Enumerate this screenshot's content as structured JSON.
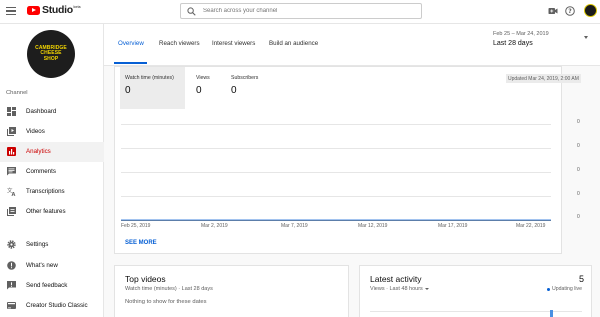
{
  "app": {
    "logo_text": "Studio",
    "logo_sup": "beta"
  },
  "search": {
    "placeholder": "Search across your channel"
  },
  "channel": {
    "logo_lines": [
      "CAMBRIDGE",
      "CHEESE",
      "SHOP"
    ],
    "section_label": "Channel"
  },
  "sidebar": {
    "items": [
      {
        "label": "Dashboard",
        "icon": "dashboard-icon",
        "active": false
      },
      {
        "label": "Videos",
        "icon": "videos-icon",
        "active": false
      },
      {
        "label": "Analytics",
        "icon": "analytics-icon",
        "active": true
      },
      {
        "label": "Comments",
        "icon": "comments-icon",
        "active": false
      },
      {
        "label": "Transcriptions",
        "icon": "transcriptions-icon",
        "active": false
      },
      {
        "label": "Other features",
        "icon": "other-features-icon",
        "active": false
      }
    ],
    "bottom_items": [
      {
        "label": "Settings",
        "icon": "settings-icon"
      },
      {
        "label": "What's new",
        "icon": "whats-new-icon"
      },
      {
        "label": "Send feedback",
        "icon": "feedback-icon"
      },
      {
        "label": "Creator Studio Classic",
        "icon": "classic-icon"
      }
    ]
  },
  "tabs": [
    {
      "label": "Overview",
      "active": true
    },
    {
      "label": "Reach viewers",
      "active": false
    },
    {
      "label": "Interest viewers",
      "active": false
    },
    {
      "label": "Build an audience",
      "active": false
    }
  ],
  "date_filter": {
    "range": "Feb 25 – Mar 24, 2019",
    "preset": "Last 28 days"
  },
  "metrics": [
    {
      "label": "Watch time (minutes)",
      "value": "0",
      "selected": true
    },
    {
      "label": "Views",
      "value": "0",
      "selected": false
    },
    {
      "label": "Subscribers",
      "value": "0",
      "selected": false
    }
  ],
  "updated": "Updated Mar 24, 2019, 2:00 AM",
  "chart_data": {
    "type": "line",
    "x": [
      "Feb 25, 2019",
      "Mar 2, 2019",
      "Mar 7, 2019",
      "Mar 12, 2019",
      "Mar 17, 2019",
      "Mar 22, 2019"
    ],
    "series": [
      {
        "values": [
          0,
          0,
          0,
          0,
          0,
          0
        ]
      }
    ],
    "y_ticks": [
      "0",
      "0",
      "0",
      "0",
      "0"
    ],
    "grid": true
  },
  "see_more": "SEE MORE",
  "top_videos": {
    "title": "Top videos",
    "subtitle": "Watch time (minutes) · Last 28 days",
    "empty": "Nothing to show for these dates"
  },
  "latest_activity": {
    "title": "Latest activity",
    "count": "5",
    "subtitle": "Views · Last 48 hours",
    "status": "Updating live"
  },
  "colors": {
    "accent": "#065fd4",
    "active_nav": "#cc0000",
    "brand_red": "#ff0000",
    "logo_yellow": "#f3d500"
  }
}
